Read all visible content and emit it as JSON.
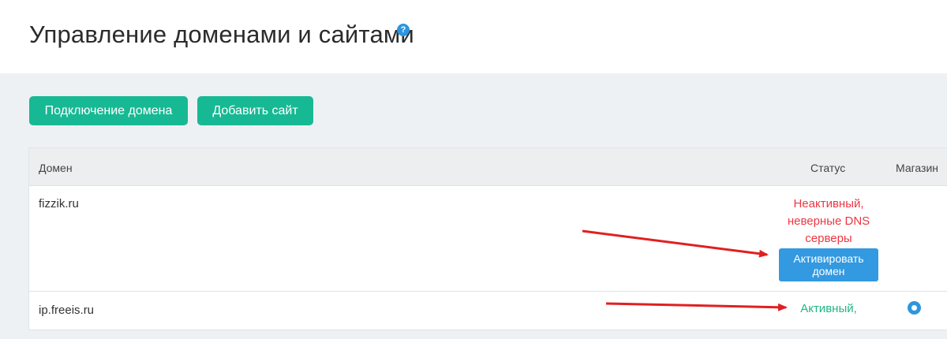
{
  "page": {
    "title": "Управление доменами и сайтами",
    "help_icon": "?"
  },
  "toolbar": {
    "connect_domain_label": "Подключение домена",
    "add_site_label": "Добавить сайт"
  },
  "colors": {
    "accent_green": "#17b994",
    "button_blue": "#3399e0",
    "status_error": "#ec3742",
    "status_ok": "#22b585",
    "arrow": "#e02020"
  },
  "table": {
    "headers": {
      "domain": "Домен",
      "status": "Статус",
      "shop": "Магазин"
    },
    "rows": [
      {
        "domain": "fizzik.ru",
        "status_lines": [
          "Неактивный,",
          "неверные DNS",
          "серверы"
        ],
        "action_lines": [
          "Активировать",
          "домен"
        ]
      },
      {
        "domain": "ip.freeis.ru",
        "status": "Активный,",
        "shop_icon": "radio-selected-icon"
      }
    ]
  }
}
